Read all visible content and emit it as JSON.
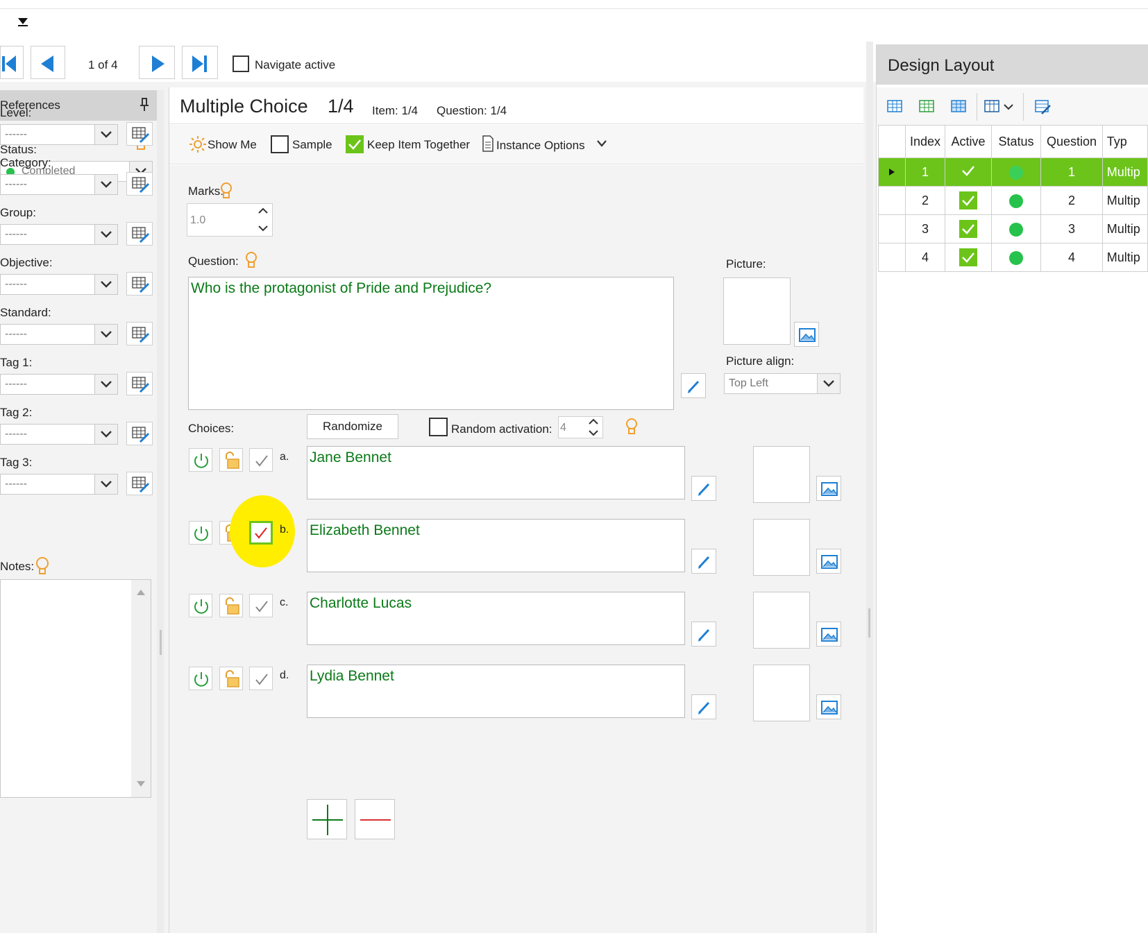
{
  "nav": {
    "page_indicator": "1 of 4",
    "navigate_active_label": "Navigate active"
  },
  "references": {
    "title": "References",
    "status_label": "Status:",
    "status_value": "Completed",
    "level_label": "Level:",
    "category_label": "Category:",
    "group_label": "Group:",
    "objective_label": "Objective:",
    "standard_label": "Standard:",
    "tag1_label": "Tag 1:",
    "tag2_label": "Tag 2:",
    "tag3_label": "Tag 3:",
    "notes_label": "Notes:",
    "empty_value": "------"
  },
  "editor": {
    "title": "Multiple Choice",
    "title_count": "1/4",
    "item_label": "Item: 1/4",
    "question_count_label": "Question: 1/4",
    "toolbar": {
      "show_me": "Show Me",
      "sample": "Sample",
      "keep_item_together": "Keep Item Together",
      "instance_options": "Instance Options"
    },
    "marks_label": "Marks:",
    "marks_value": "1.0",
    "question_label": "Question:",
    "question_text": "Who is the protagonist of Pride and Prejudice?",
    "picture_label": "Picture:",
    "picture_align_label": "Picture align:",
    "picture_align_value": "Top Left",
    "choices_label": "Choices:",
    "randomize_label": "Randomize",
    "random_activation_label": "Random activation:",
    "random_activation_value": "4",
    "choices": [
      {
        "letter": "a.",
        "text": "Jane Bennet",
        "correct": false
      },
      {
        "letter": "b.",
        "text": "Elizabeth Bennet",
        "correct": true
      },
      {
        "letter": "c.",
        "text": "Charlotte Lucas",
        "correct": false
      },
      {
        "letter": "d.",
        "text": "Lydia Bennet",
        "correct": false
      }
    ]
  },
  "design_layout": {
    "title": "Design Layout",
    "columns": [
      "Index",
      "Active",
      "Status",
      "Question",
      "Typ"
    ],
    "rows": [
      {
        "index": "1",
        "question": "1",
        "type": "Multip",
        "selected": true
      },
      {
        "index": "2",
        "question": "2",
        "type": "Multip",
        "selected": false
      },
      {
        "index": "3",
        "question": "3",
        "type": "Multip",
        "selected": false
      },
      {
        "index": "4",
        "question": "4",
        "type": "Multip",
        "selected": false
      }
    ]
  },
  "colors": {
    "accent_green": "#6cc41a",
    "text_green": "#0b7a18",
    "nav_blue": "#1e7fd4",
    "highlight_yellow": "#ffee00",
    "bulb_orange": "#f0a030"
  }
}
